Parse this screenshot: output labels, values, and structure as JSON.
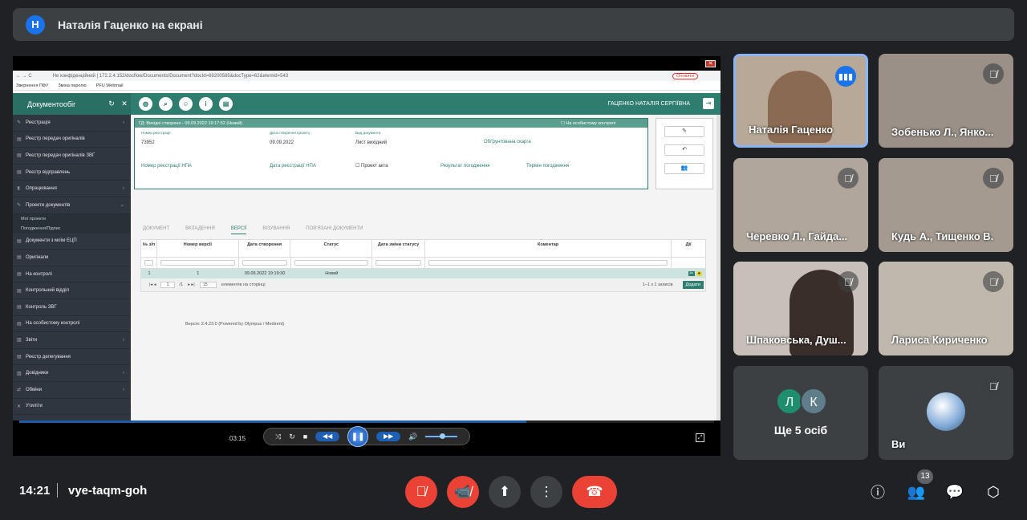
{
  "banner": {
    "avatar_letter": "Н",
    "text": "Наталія Гаценко на екрані"
  },
  "screen": {
    "browser": {
      "url": "Не конфіденційний | 172.2.4.152/docflow/Documents/Document?docId=69200585&docType=62&elemId=543",
      "update_label": "Оновити",
      "bookmarks": [
        "Звернення ПФУ",
        "Зміна паролю",
        "PFU Webmail"
      ]
    },
    "app": {
      "brand": "Документообіг",
      "user": "ГАЦЕНКО НАТАЛІЯ СЕРГІЇВНА",
      "toolbar_icons": [
        "globe-icon",
        "search-doc-icon",
        "user-search-icon",
        "info-icon",
        "file-icon"
      ]
    },
    "sidebar": [
      {
        "label": "Реєстрація",
        "icon": "pen-icon",
        "chevron": "‹"
      },
      {
        "label": "Реєстр передач оригіналів",
        "icon": "list-icon"
      },
      {
        "label": "Реєстр передач оригіналів ЗВГ",
        "icon": "list-icon"
      },
      {
        "label": "Реєстр відправлень",
        "icon": "list-icon"
      },
      {
        "label": "Опрацювання",
        "icon": "hourglass-icon",
        "chevron": "‹"
      },
      {
        "label": "Проекти документів",
        "icon": "edit-icon",
        "chevron": "⌄"
      }
    ],
    "sidebar_sub": [
      "Мої проекти",
      "Погодження/Підпис"
    ],
    "sidebar_rest": [
      {
        "label": "Документи з моїм ЕЦП",
        "icon": "doc-icon"
      },
      {
        "label": "Оригінали",
        "icon": "doc-icon"
      },
      {
        "label": "На контролі",
        "icon": "doc-icon"
      },
      {
        "label": "Контрольний відділ",
        "icon": "doc-icon"
      },
      {
        "label": "Контроль ЗВГ",
        "icon": "doc-icon"
      },
      {
        "label": "На особистому контролі",
        "icon": "doc-icon"
      },
      {
        "label": "Звіти",
        "icon": "chart-icon",
        "chevron": "‹"
      },
      {
        "label": "Реєстр делегування",
        "icon": "list-icon"
      },
      {
        "label": "Довідники",
        "icon": "book-icon",
        "chevron": "‹"
      },
      {
        "label": "Обміни",
        "icon": "exchange-icon",
        "chevron": "‹"
      },
      {
        "label": "Утиліти",
        "icon": "tool-icon"
      }
    ],
    "card": {
      "header": "ГД: Вихідні створено - 09.09.2022 19:17:52 (Новий)",
      "personal_control": "На особистому контролі",
      "reg_no_label": "Номер реєстрації",
      "reg_no": "73952",
      "created_label": "Дата створення проекту",
      "created": "09.09.2022",
      "doc_type_label": "Вид документа",
      "doc_type": "Лист вихідний",
      "grounded": "Обґрунтована скарга",
      "npa_no": "Номер реєстрації НПА",
      "npa_date": "Дата реєстрації НПА",
      "act_project": "Проект акта",
      "result": "Результат погодження",
      "term": "Термін погодження"
    },
    "tabs": [
      "ДОКУМЕНТ",
      "ВКЛАДЕННЯ",
      "ВЕРСІЇ",
      "ВІЗУВАННЯ",
      "ПОВ'ЯЗАНІ ДОКУМЕНТИ"
    ],
    "table": {
      "headers": [
        "№ з/п",
        "Номер версії",
        "Дата створення",
        "Статус",
        "Дата зміни статусу",
        "Коментар",
        "Дії"
      ],
      "row": [
        "1",
        "1",
        "09.09.2022 19:19:30",
        "Новий",
        "",
        ""
      ],
      "page": "1",
      "of_pages": "/1",
      "per_page": "15",
      "per_page_label": "елементів на сторінці",
      "count": "1–1 з 1 записів",
      "add": "Додати"
    },
    "version": "Версія: 2.4.23.0 (Powered by Olympus / Medirent)"
  },
  "player": {
    "time": "03:15",
    "progress_fraction": 0.73
  },
  "tiles": [
    {
      "name": "Наталія Гаценко",
      "state": "speaking"
    },
    {
      "name": "Зобенько Л., Янко...",
      "state": "muted"
    },
    {
      "name": "Черевко Л., Гайда...",
      "state": "muted"
    },
    {
      "name": "Кудь А., Тищенко В.",
      "state": "muted"
    },
    {
      "name": "Шпаковська, Душ...",
      "state": "muted"
    },
    {
      "name": "Лариса Кириченко",
      "state": "muted"
    },
    {
      "name": "Ще 5 осіб",
      "avatars": [
        "Л",
        "К"
      ]
    },
    {
      "name": "Ви",
      "state": "muted"
    }
  ],
  "bottom": {
    "clock": "14:21",
    "meeting_code": "vye-taqm-goh",
    "participants_count": "13"
  },
  "colors": {
    "end_call": "#ea4335",
    "mic_off": "#ea4335",
    "teal": "#2e7d6e",
    "speaking": "#1a73e8"
  }
}
